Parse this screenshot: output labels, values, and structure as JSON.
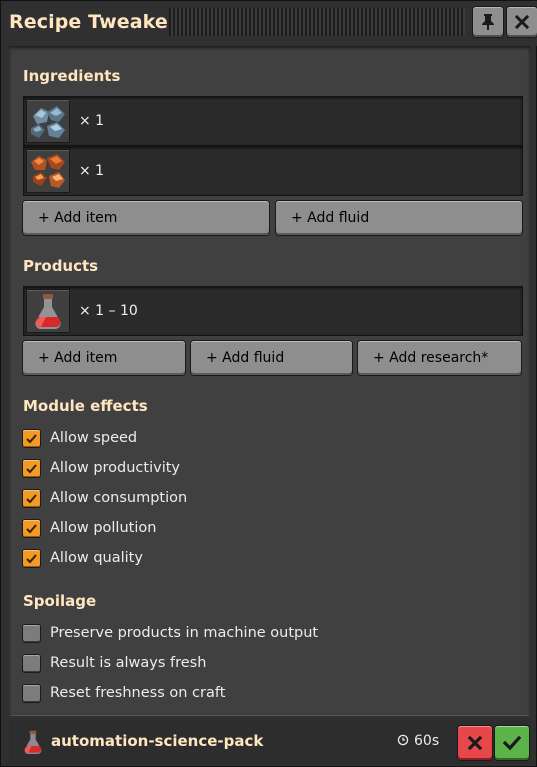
{
  "window": {
    "title": "Recipe Tweaker"
  },
  "titlebar": {
    "pin_icon": "pin-icon",
    "close_icon": "close-icon"
  },
  "ingredients": {
    "title": "Ingredients",
    "items": [
      {
        "icon": "iron-ore-icon",
        "amount": "× 1"
      },
      {
        "icon": "copper-ore-icon",
        "amount": "× 1"
      }
    ],
    "add_item_label": "+ Add item",
    "add_fluid_label": "+ Add fluid"
  },
  "products": {
    "title": "Products",
    "items": [
      {
        "icon": "automation-science-pack-icon",
        "amount": "× 1 – 10"
      }
    ],
    "add_item_label": "+ Add item",
    "add_fluid_label": "+ Add fluid",
    "add_research_label": "+ Add research*"
  },
  "module_effects": {
    "title": "Module effects",
    "options": [
      {
        "label": "Allow speed",
        "checked": true
      },
      {
        "label": "Allow productivity",
        "checked": true
      },
      {
        "label": "Allow consumption",
        "checked": true
      },
      {
        "label": "Allow pollution",
        "checked": true
      },
      {
        "label": "Allow quality",
        "checked": true
      }
    ]
  },
  "spoilage": {
    "title": "Spoilage",
    "options": [
      {
        "label": "Preserve products in machine output",
        "checked": false
      },
      {
        "label": "Result is always fresh",
        "checked": false
      },
      {
        "label": "Reset freshness on craft",
        "checked": false
      }
    ]
  },
  "footer": {
    "recipe_name": "automation-science-pack",
    "time": "60s",
    "cancel_icon": "cancel-icon",
    "confirm_icon": "confirm-icon"
  },
  "colors": {
    "heading": "#ffe6c0",
    "checkbox_on": "#f19a27",
    "cancel": "#e6474a",
    "confirm": "#5cb34a"
  }
}
